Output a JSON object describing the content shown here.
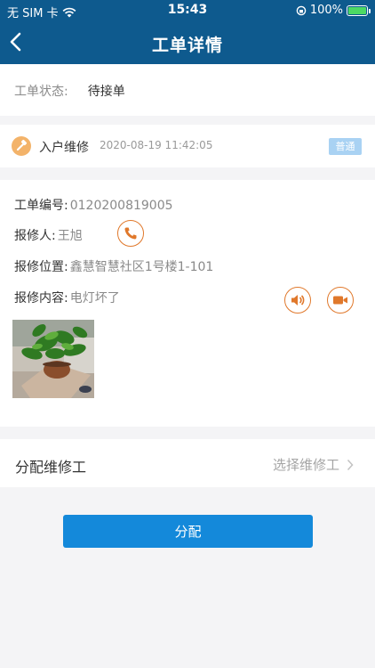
{
  "status_bar": {
    "carrier": "无 SIM 卡",
    "time": "15:43",
    "battery": "100%"
  },
  "nav": {
    "title": "工单详情",
    "back_icon": "chevron-left-icon"
  },
  "order_status": {
    "label": "工单状态:",
    "value": "待接单"
  },
  "order_type": {
    "icon": "hammer-icon",
    "title": "入户维修",
    "time": "2020-08-19 11:42:05",
    "priority": "普通"
  },
  "details": {
    "number_label": "工单编号:",
    "number_value": "0120200819005",
    "reporter_label": "报修人:",
    "reporter_value": "王旭",
    "location_label": "报修位置:",
    "location_value": "鑫慧智慧社区1号楼1-101",
    "content_label": "报修内容:",
    "content_value": "电灯坏了",
    "icons": {
      "phone": "phone-icon",
      "audio": "speaker-icon",
      "video": "video-camera-icon"
    }
  },
  "assign": {
    "label": "分配维修工",
    "placeholder": "选择维修工",
    "button": "分配"
  },
  "colors": {
    "header": "#0e5a8e",
    "accent_orange": "#e0782b",
    "button_blue": "#1489da",
    "badge_blue": "#a9d2f3"
  }
}
